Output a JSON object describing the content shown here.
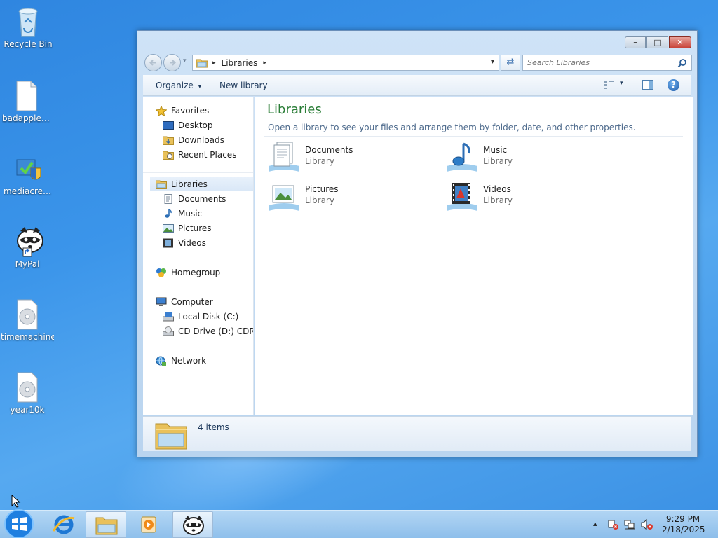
{
  "desktop": {
    "icons": [
      {
        "label": "Recycle Bin"
      },
      {
        "label": "badappleflash"
      },
      {
        "label": "mediacreationtool"
      },
      {
        "label": "MyPal"
      },
      {
        "label": "timemachine"
      },
      {
        "label": "year10k"
      }
    ]
  },
  "window": {
    "caption": {
      "minimize": "–",
      "maximize": "□",
      "close": "✕"
    },
    "address": {
      "crumb": "Libraries",
      "sep": "▸",
      "dropdown": "▾"
    },
    "refresh_glyph": "⇄",
    "search": {
      "placeholder": "Search Libraries"
    },
    "commands": {
      "organize": "Organize",
      "organize_arrow": "▾",
      "new_library": "New library",
      "help": "?"
    },
    "nav": {
      "favorites": "Favorites",
      "favorites_items": [
        "Desktop",
        "Downloads",
        "Recent Places"
      ],
      "libraries": "Libraries",
      "libraries_items": [
        "Documents",
        "Music",
        "Pictures",
        "Videos"
      ],
      "homegroup": "Homegroup",
      "computer": "Computer",
      "computer_items": [
        "Local Disk (C:)",
        "CD Drive (D:) CDROM"
      ],
      "network": "Network"
    },
    "content": {
      "title": "Libraries",
      "description": "Open a library to see your files and arrange them by folder, date, and other properties.",
      "libraries": [
        {
          "name": "Documents",
          "type": "Library"
        },
        {
          "name": "Music",
          "type": "Library"
        },
        {
          "name": "Pictures",
          "type": "Library"
        },
        {
          "name": "Videos",
          "type": "Library"
        }
      ]
    },
    "status": {
      "count": "4 items"
    }
  },
  "taskbar": {
    "clock": {
      "time": "9:29 PM",
      "date": "2/18/2025"
    },
    "tray_arrow": "▴"
  }
}
